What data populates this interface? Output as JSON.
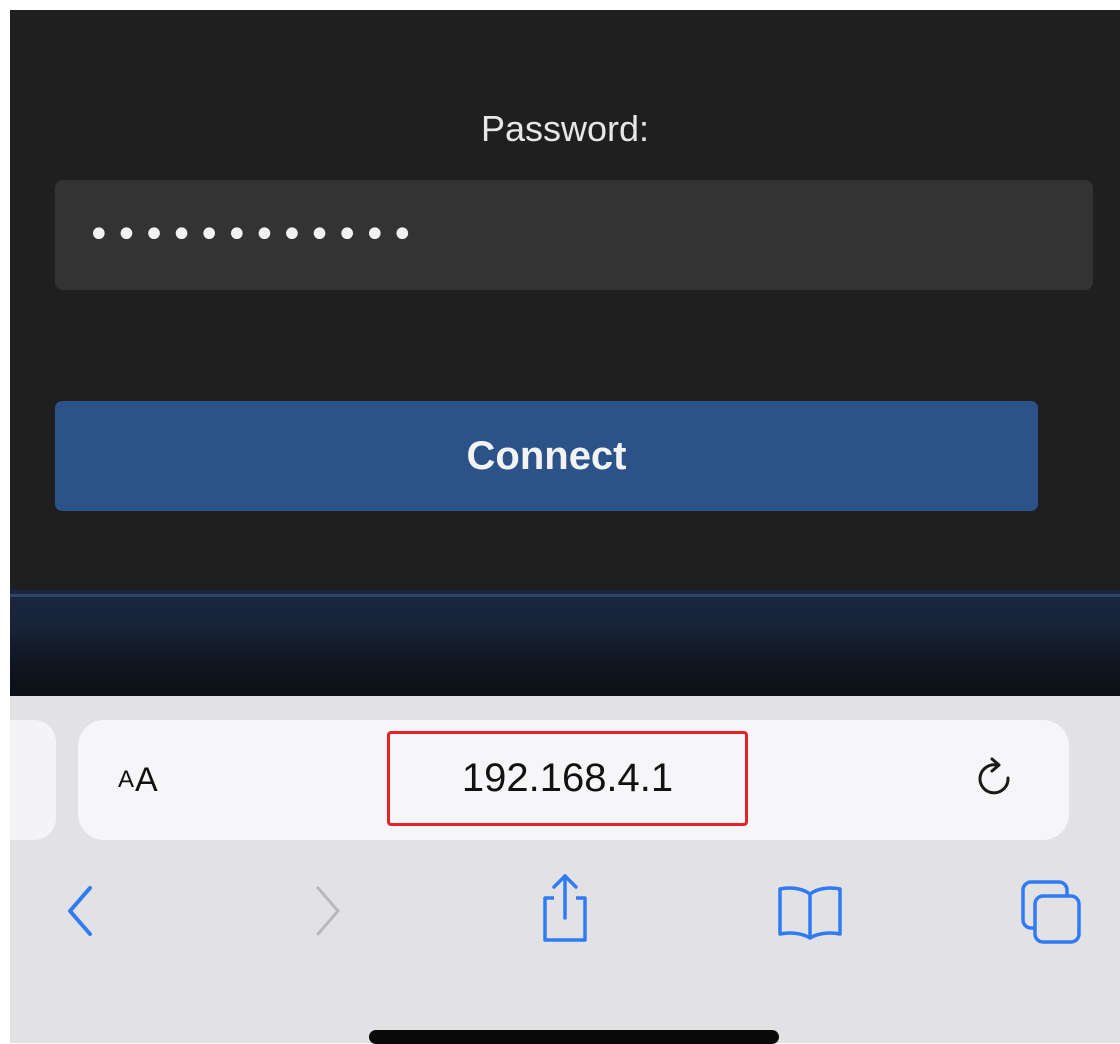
{
  "page": {
    "password_label": "Password:",
    "password_value": "••••••••••••",
    "connect_label": "Connect"
  },
  "browser": {
    "text_size_button": {
      "small": "A",
      "large": "A"
    },
    "url": "192.168.4.1",
    "icons": {
      "reload": "reload-icon",
      "back": "chevron-left-icon",
      "forward": "chevron-right-icon",
      "share": "share-icon",
      "bookmarks": "book-icon",
      "tabs": "tabs-icon"
    },
    "forward_enabled": false
  },
  "colors": {
    "page_background": "#1f1f20",
    "field_background": "#333334",
    "connect_button": "#2b5289",
    "highlight_border": "#e4222a",
    "toolbar_icon": "#2f7bf6",
    "toolbar_icon_disabled": "#b9b9bd",
    "browser_chrome": "#e2e2e4"
  }
}
